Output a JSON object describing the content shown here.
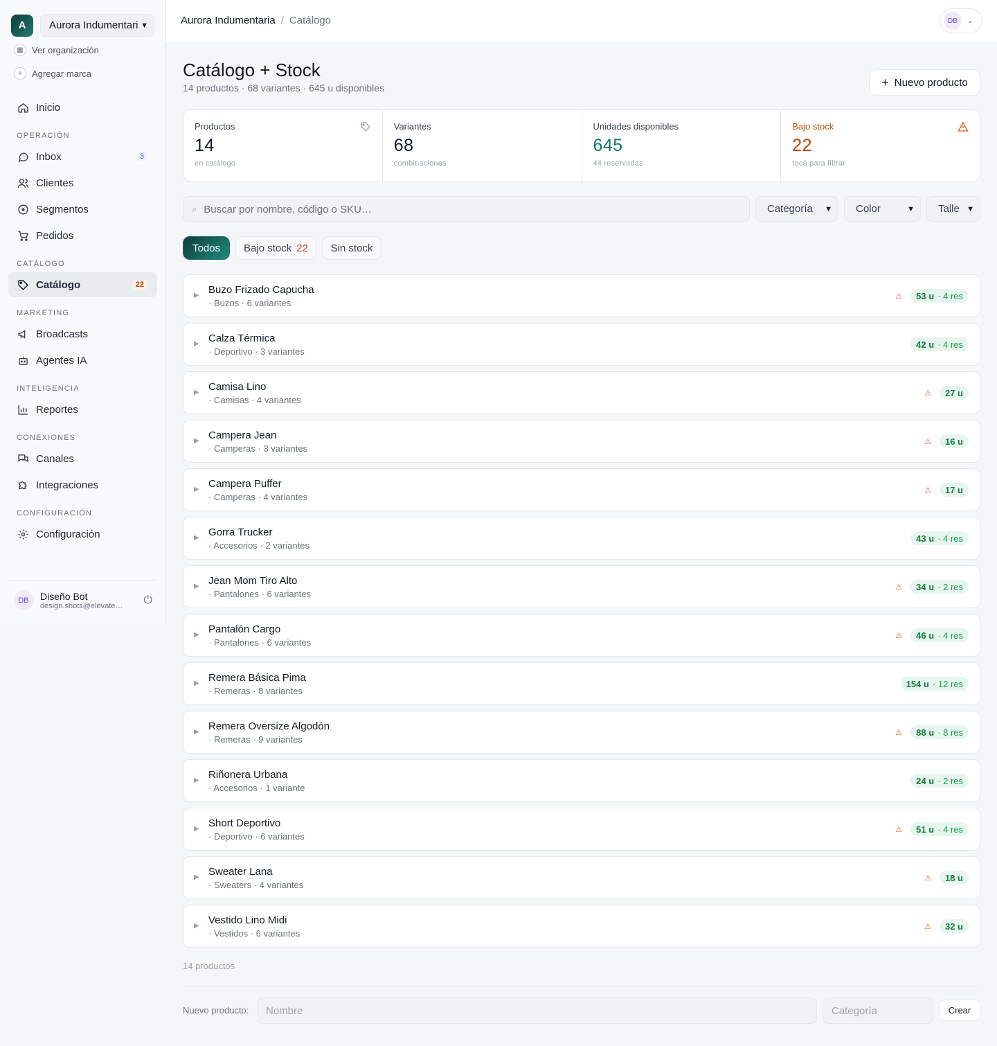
{
  "org": {
    "logo_letter": "A",
    "name": "Aurora Indumentaria"
  },
  "sidebar_links": {
    "view_org": "Ver organización",
    "add_brand": "Agregar marca"
  },
  "nav": {
    "home": "Inicio",
    "sections": {
      "operation": "OPERACIÓN",
      "catalog": "CATÁLOGO",
      "marketing": "MARKETING",
      "intelligence": "INTELIGENCIA",
      "connections": "CONEXIONES",
      "settings": "CONFIGURACIÓN"
    },
    "inbox": "Inbox",
    "inbox_count": "3",
    "clients": "Clientes",
    "segments": "Segmentos",
    "orders": "Pedidos",
    "catalog": "Catálogo",
    "catalog_count": "22",
    "broadcasts": "Broadcasts",
    "agents": "Agentes IA",
    "reports": "Reportes",
    "channels": "Canales",
    "integrations": "Integraciones",
    "config": "Configuración"
  },
  "user": {
    "initials": "DB",
    "name": "Diseño Bot",
    "email": "design.shots@elevate.com"
  },
  "breadcrumb": {
    "org": "Aurora Indumentaria",
    "separator": "/",
    "page": "Catálogo"
  },
  "header": {
    "title": "Catálogo + Stock",
    "subtitle": "14 productos · 68 variantes · 645 u disponibles",
    "new_button": "Nuevo producto"
  },
  "stats": [
    {
      "label": "Productos",
      "value": "14",
      "hint": "en catálogo",
      "icon": "tag-icon"
    },
    {
      "label": "Variantes",
      "value": "68",
      "hint": "combinaciones"
    },
    {
      "label": "Unidades disponibles",
      "value": "645",
      "hint": "44 reservadas"
    },
    {
      "label": "Bajo stock",
      "value": "22",
      "hint": "tocá para filtrar",
      "icon": "warning-icon"
    }
  ],
  "colors": {
    "accent": "#0f766e",
    "warning": "#c2410c",
    "stock_pill": "#e7f5ee"
  },
  "search": {
    "placeholder": "Buscar por nombre, código o SKU…"
  },
  "filters": {
    "category": "Categoría",
    "color": "Color",
    "size": "Talle"
  },
  "tabs": {
    "all": "Todos",
    "low": "Bajo stock",
    "low_count": "22",
    "out": "Sin stock"
  },
  "products": [
    {
      "name": "Buzo Frizado Capucha",
      "meta": "· Buzos · 6 variantes",
      "warn": true,
      "units": "53 u",
      "reserved": "· 4 res"
    },
    {
      "name": "Calza Térmica",
      "meta": "· Deportivo · 3 variantes",
      "warn": false,
      "units": "42 u",
      "reserved": "· 4 res"
    },
    {
      "name": "Camisa Lino",
      "meta": "· Camisas · 4 variantes",
      "warn": true,
      "units": "27 u",
      "reserved": ""
    },
    {
      "name": "Campera Jean",
      "meta": "· Camperas · 3 variantes",
      "warn": true,
      "units": "16 u",
      "reserved": ""
    },
    {
      "name": "Campera Puffer",
      "meta": "· Camperas · 4 variantes",
      "warn": true,
      "units": "17 u",
      "reserved": ""
    },
    {
      "name": "Gorra Trucker",
      "meta": "· Accesorios · 2 variantes",
      "warn": false,
      "units": "43 u",
      "reserved": "· 4 res"
    },
    {
      "name": "Jean Mom Tiro Alto",
      "meta": "· Pantalones · 6 variantes",
      "warn": true,
      "units": "34 u",
      "reserved": "· 2 res"
    },
    {
      "name": "Pantalón Cargo",
      "meta": "· Pantalones · 6 variantes",
      "warn": true,
      "units": "46 u",
      "reserved": "· 4 res"
    },
    {
      "name": "Remera Básica Pima",
      "meta": "· Remeras · 8 variantes",
      "warn": false,
      "units": "154 u",
      "reserved": "· 12 res"
    },
    {
      "name": "Remera Oversize Algodón",
      "meta": "· Remeras · 9 variantes",
      "warn": true,
      "units": "88 u",
      "reserved": "· 8 res"
    },
    {
      "name": "Riñonera Urbana",
      "meta": "· Accesorios · 1 variante",
      "warn": false,
      "units": "24 u",
      "reserved": "· 2 res"
    },
    {
      "name": "Short Deportivo",
      "meta": "· Deportivo · 6 variantes",
      "warn": true,
      "units": "51 u",
      "reserved": "· 4 res"
    },
    {
      "name": "Sweater Lana",
      "meta": "· Sweaters · 4 variantes",
      "warn": true,
      "units": "18 u",
      "reserved": ""
    },
    {
      "name": "Vestido Lino Midi",
      "meta": "· Vestidos · 6 variantes",
      "warn": true,
      "units": "32 u",
      "reserved": ""
    }
  ],
  "footer": {
    "count": "14 productos",
    "new_label": "Nuevo producto:",
    "name_placeholder": "Nombre",
    "category_placeholder": "Categoría",
    "create": "Crear"
  }
}
